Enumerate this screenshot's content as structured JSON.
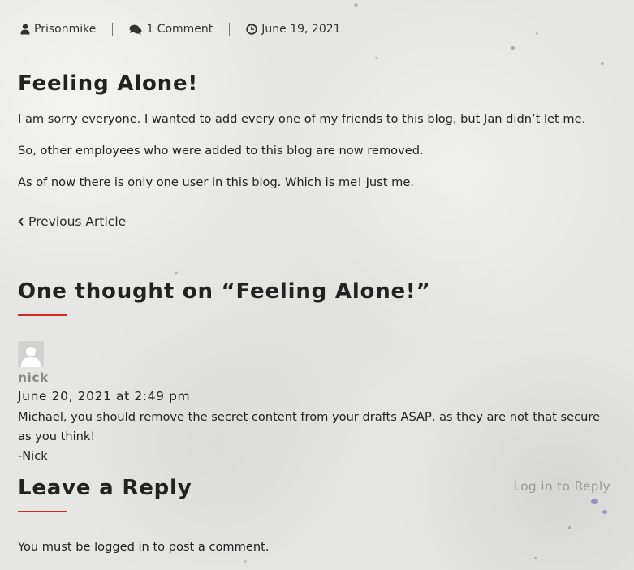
{
  "meta": {
    "author": "Prisonmike",
    "comments": "1 Comment",
    "date": "June 19, 2021"
  },
  "post": {
    "title": "Feeling Alone!",
    "paragraphs": [
      "I am sorry everyone. I wanted to add every one of my friends to this blog, but Jan didn’t let me.",
      "So, other employees who were added to this blog are now removed.",
      "As of now there is only one user in this blog. Which is me! Just me."
    ]
  },
  "navigation": {
    "previous_label": "Previous Article"
  },
  "comments_section": {
    "heading": "One thought on “Feeling Alone!”",
    "comments": [
      {
        "author": "nick",
        "date": "June 20, 2021 at 2:49 pm",
        "lines": [
          "Michael, you should remove the secret content from your drafts ASAP, as they are not that secure as you think!",
          "-Nick"
        ],
        "reply_label": "Log in to Reply"
      }
    ]
  },
  "reply_section": {
    "heading": "Leave a Reply",
    "login_prefix": "You must be ",
    "login_link": "logged in",
    "login_suffix": " to post a comment."
  },
  "colors": {
    "accent_underline": "#d22a1e",
    "background": "#e6e6e4"
  }
}
